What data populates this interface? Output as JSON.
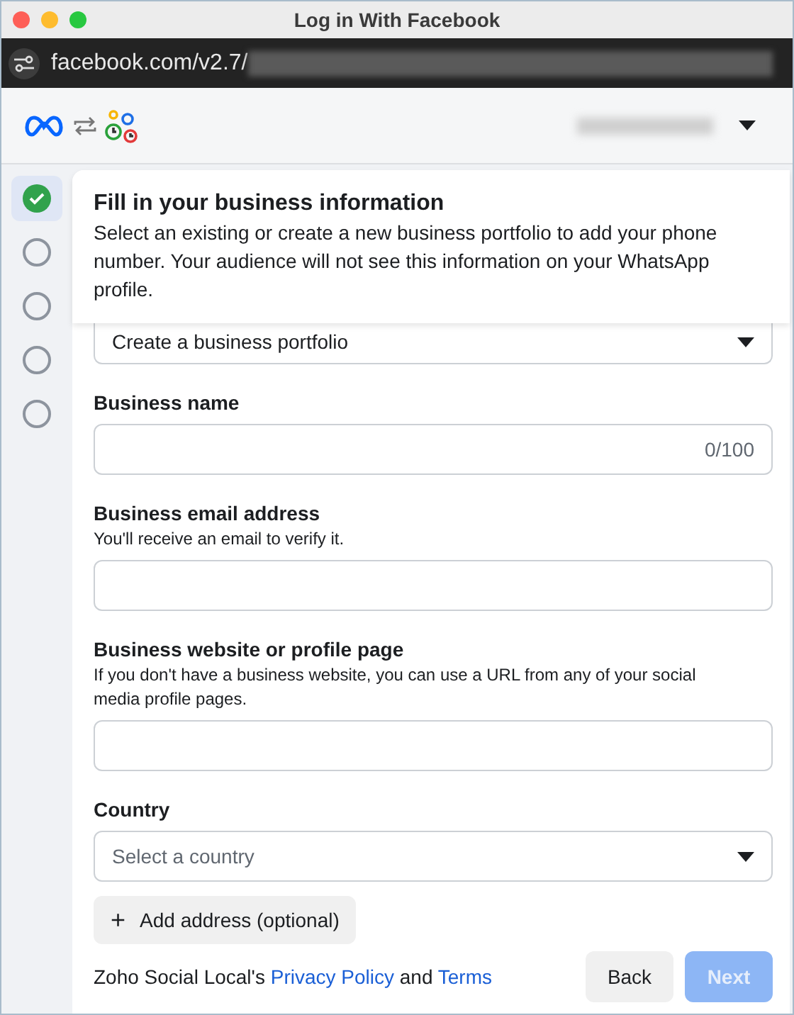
{
  "window": {
    "title": "Log in With Facebook"
  },
  "address_bar": {
    "url": "facebook.com/v2.7/"
  },
  "steps": [
    {
      "done": true,
      "selected": true
    },
    {
      "done": false,
      "selected": false
    },
    {
      "done": false,
      "selected": false
    },
    {
      "done": false,
      "selected": false
    },
    {
      "done": false,
      "selected": false
    }
  ],
  "form": {
    "title": "Fill in your business information",
    "description": "Select an existing or create a new business portfolio to add your phone number. Your audience will not see this information on your WhatsApp profile.",
    "portfolio": {
      "value": "Create a business portfolio"
    },
    "fields": [
      {
        "kind": "text",
        "label": "Business name",
        "counter": "0/100"
      },
      {
        "kind": "text",
        "label": "Business email address",
        "help": "You'll receive an email to verify it."
      },
      {
        "kind": "text",
        "label": "Business website or profile page",
        "help": "If you don't have a business website, you can use a URL from any of your social media profile pages."
      },
      {
        "kind": "select",
        "label": "Country",
        "placeholder": "Select a country"
      }
    ],
    "add_button": {
      "icon": "+",
      "label": "Add address (optional)"
    }
  },
  "footer": {
    "prefix": "Zoho Social Local's",
    "privacy_link": "Privacy Policy",
    "conjunction": "and",
    "terms_link": "Terms",
    "back": "Back",
    "next": {
      "label": "Next",
      "disabled": true
    }
  }
}
